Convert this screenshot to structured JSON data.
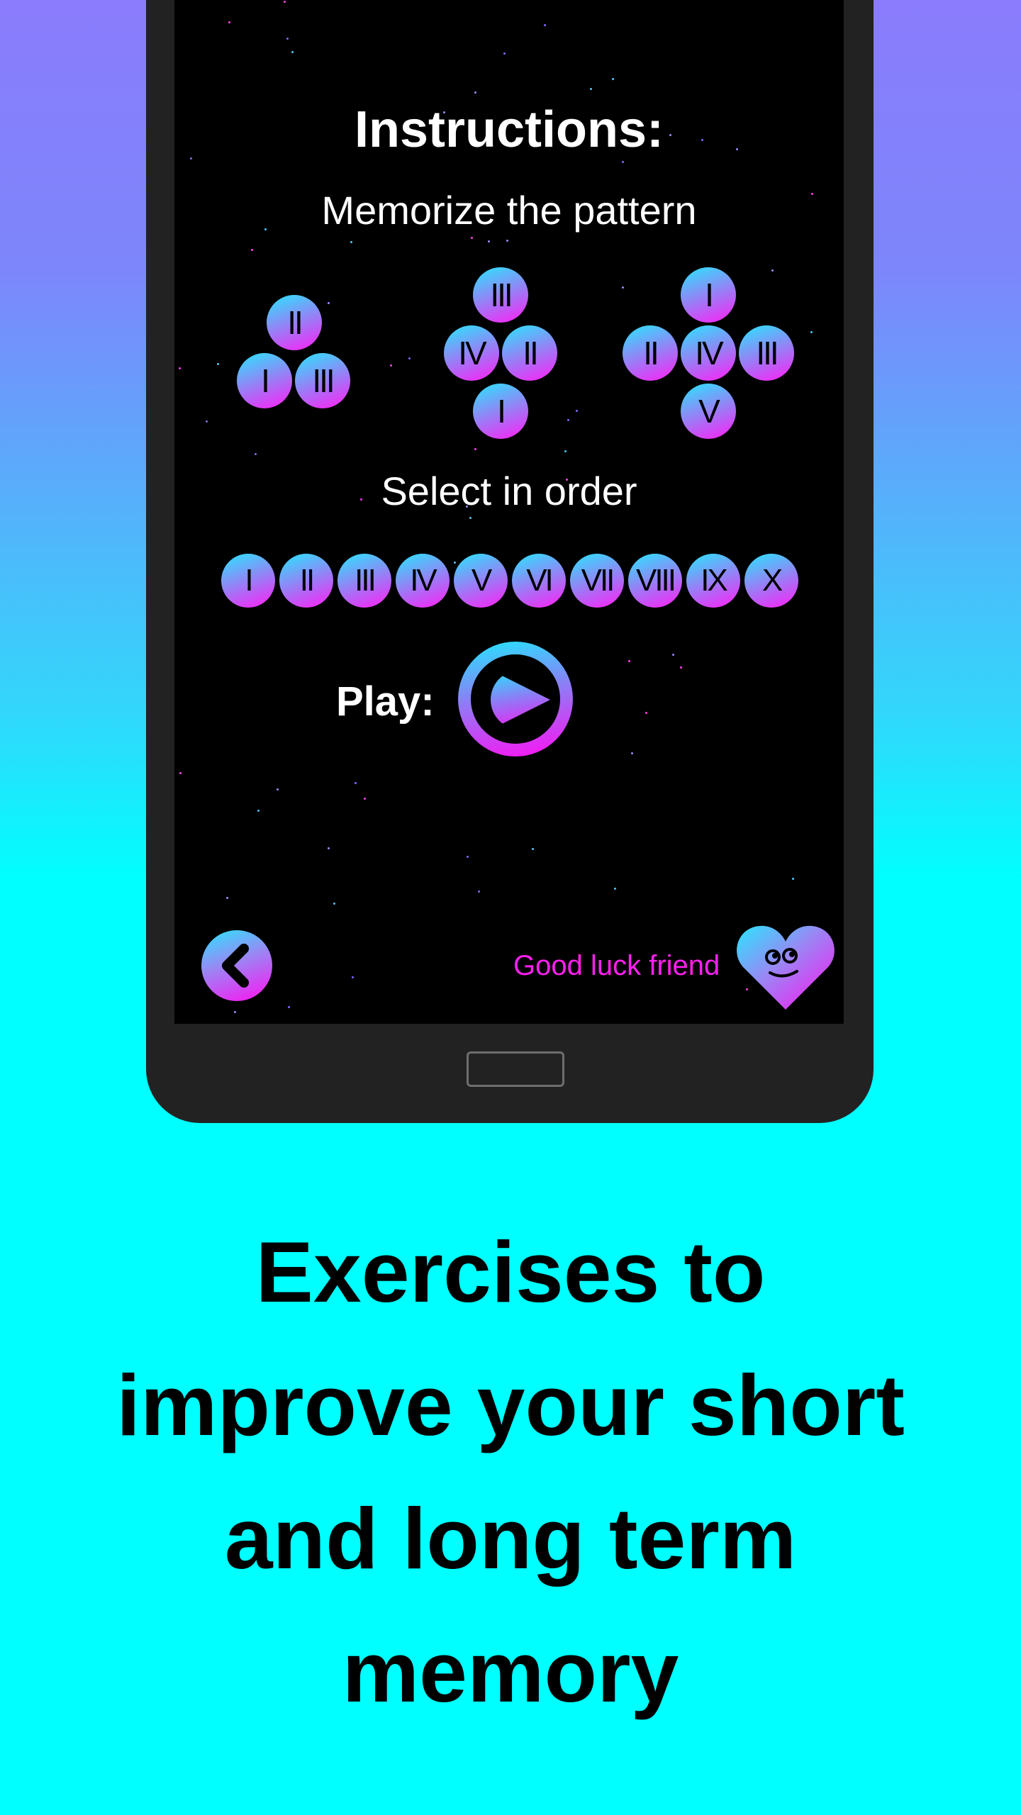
{
  "instructions": {
    "title": "Instructions:",
    "memorize_text": "Memorize the pattern",
    "select_text": "Select in order",
    "play_label": "Play:"
  },
  "patterns": [
    {
      "balls": [
        "II",
        "I",
        "III"
      ]
    },
    {
      "balls": [
        "III",
        "IV",
        "II",
        "I"
      ]
    },
    {
      "balls": [
        "I",
        "II",
        "IV",
        "III",
        "V"
      ]
    }
  ],
  "order_sequence": [
    "I",
    "II",
    "III",
    "IV",
    "V",
    "VI",
    "VII",
    "VIII",
    "IX",
    "X"
  ],
  "footer": {
    "good_luck_text": "Good luck friend",
    "back_icon": "chevron-left-icon",
    "mascot_icon": "heart-face-icon"
  },
  "headline": {
    "line1": "Exercises to",
    "line2": "improve your short",
    "line3": "and long term",
    "line4": "memory"
  },
  "colors": {
    "accent_cyan": "#22e8ff",
    "accent_magenta": "#ff10f2",
    "screen_bg": "#000000",
    "phone_frame": "#222222"
  }
}
